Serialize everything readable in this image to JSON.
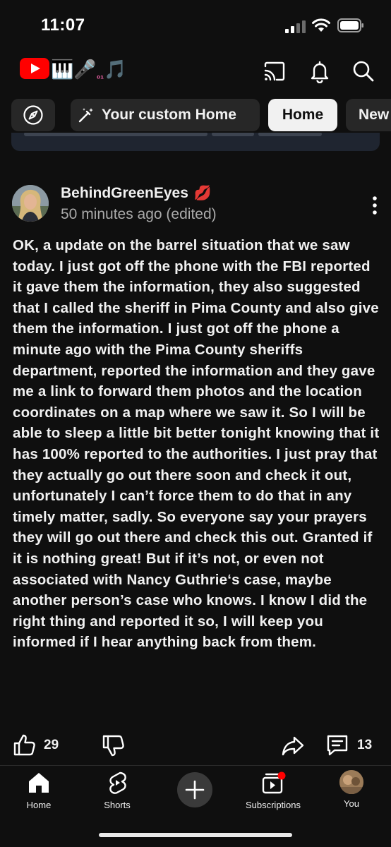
{
  "status_bar": {
    "time": "11:07",
    "icons": [
      "cellular-signal-icon",
      "wifi-icon",
      "battery-icon"
    ]
  },
  "header": {
    "logo": "youtube-logo",
    "emoji_decoration": [
      "🎹",
      "🎤",
      "₀₁",
      "🎵"
    ],
    "actions": [
      "cast-icon",
      "bell-icon",
      "search-icon"
    ]
  },
  "chips": {
    "explore_icon": "compass-icon",
    "custom_label": "Your custom Home",
    "custom_icon": "magic-wand-icon",
    "home_label": "Home",
    "new_label": "New"
  },
  "post": {
    "author": "BehindGreenEyes",
    "author_emoji": "💋",
    "meta": "50 minutes ago (edited)",
    "body": "OK, a update on the barrel situation that we saw today. I just got off the phone with the FBI reported it gave them the information, they also suggested that I called the sheriff in Pima County and also give them the information. I just got off the phone a minute ago with the Pima County sheriffs department, reported the information and they gave me a link to forward them photos and the location coordinates on a map where we saw it. So I will be able to sleep a little bit better tonight knowing that it has 100% reported to the authorities. I just pray that they actually go out there soon and check it out, unfortunately I can’t force them to do that in any timely matter, sadly. So everyone say your prayers they will go out there and check this out. Granted if it is nothing great! But if it’s not, or even not associated with Nancy Guthrie‘s case, maybe another person’s case who knows. I know I did the right thing and reported it so, I will keep you informed if I hear anything back from them."
  },
  "actions": {
    "like_count": "29",
    "comment_count": "13"
  },
  "bottom_nav": {
    "home": "Home",
    "shorts": "Shorts",
    "subscriptions": "Subscriptions",
    "you": "You"
  },
  "colors": {
    "background": "#0f0f0f",
    "chip_bg": "#272727",
    "chip_active_bg": "#f1f1f1",
    "youtube_red": "#ff0000",
    "notification_dot": "#ff0000",
    "secondary_text": "#aaaaaa"
  }
}
